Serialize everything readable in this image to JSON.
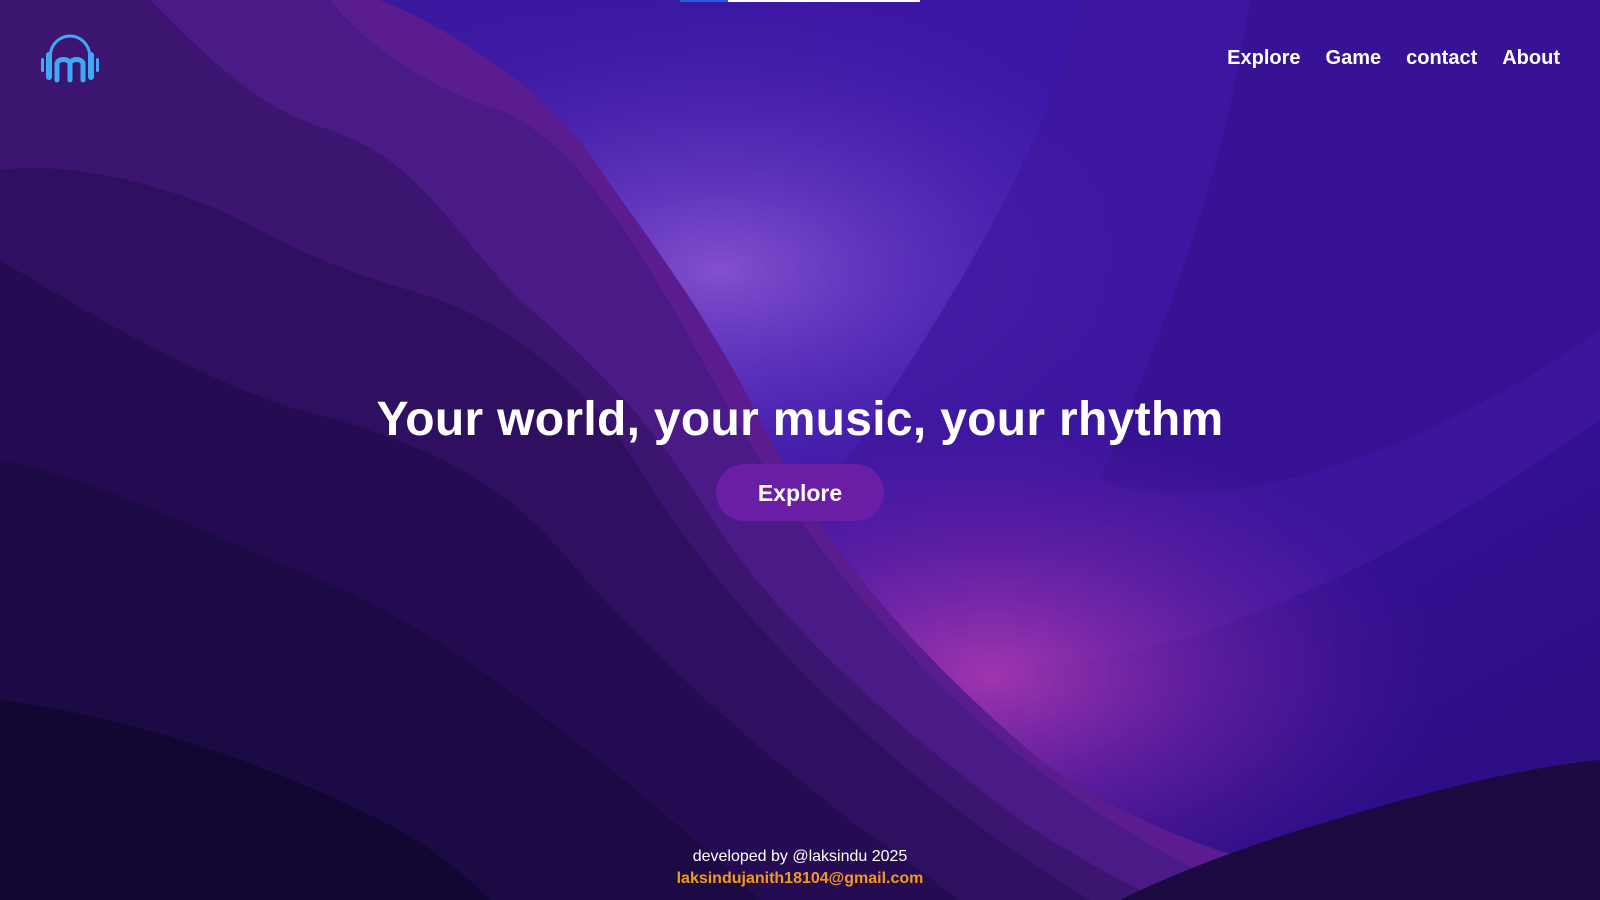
{
  "nav": {
    "logo_icon": "headphones-music-logo-icon",
    "links": [
      {
        "label": "Explore"
      },
      {
        "label": "Game"
      },
      {
        "label": "contact"
      },
      {
        "label": "About"
      }
    ]
  },
  "hero": {
    "title": "Your world, your music, your rhythm",
    "button_label": "Explore"
  },
  "footer": {
    "credit": "developed by @laksindu 2025",
    "email": "laksindujanith18104@gmail.com"
  },
  "colors": {
    "logo": "#3fa9f5",
    "button": "#6a1ea6",
    "email": "#f39a1e",
    "background": "#2a0f7a"
  }
}
